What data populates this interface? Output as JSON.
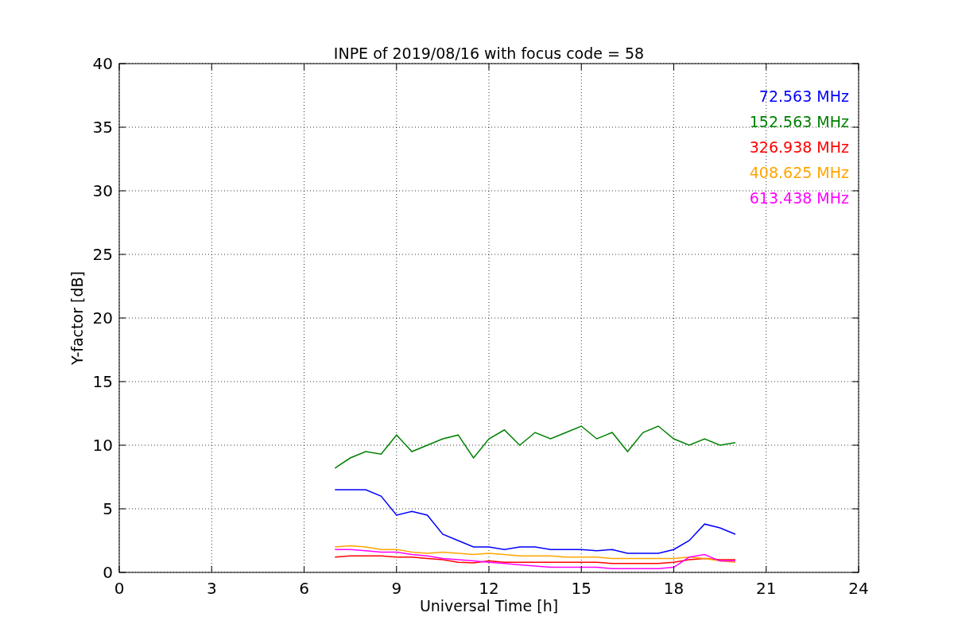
{
  "chart_data": {
    "type": "line",
    "title": "INPE of 2019/08/16 with focus code = 58",
    "xlabel": "Universal Time [h]",
    "ylabel": "Y-factor [dB]",
    "x": [
      7,
      7.5,
      8,
      8.5,
      9,
      9.5,
      10,
      10.5,
      11,
      11.5,
      12,
      12.5,
      13,
      13.5,
      14,
      14.5,
      15,
      15.5,
      16,
      16.5,
      17,
      17.5,
      18,
      18.5,
      19,
      19.5,
      20
    ],
    "series": [
      {
        "name": "72.563 MHz",
        "color": "#0000ff",
        "values": [
          6.5,
          6.5,
          6.5,
          6,
          4.5,
          4.8,
          4.5,
          3,
          2.5,
          2,
          2,
          1.8,
          2,
          2,
          1.8,
          1.8,
          1.8,
          1.7,
          1.8,
          1.5,
          1.5,
          1.5,
          1.8,
          2.5,
          3.8,
          3.5,
          3
        ]
      },
      {
        "name": "152.563 MHz",
        "color": "#008000",
        "values": [
          8.2,
          9,
          9.5,
          9.3,
          10.8,
          9.5,
          10,
          10.5,
          10.8,
          9,
          10.5,
          11.2,
          10,
          11,
          10.5,
          11,
          11.5,
          10.5,
          11,
          9.5,
          11,
          11.5,
          10.5,
          10,
          10.5,
          10,
          10.2
        ]
      },
      {
        "name": "326.938 MHz",
        "color": "#ff0000",
        "values": [
          1.2,
          1.3,
          1.3,
          1.3,
          1.2,
          1.2,
          1.1,
          1,
          0.8,
          0.75,
          0.9,
          0.8,
          0.8,
          0.8,
          0.8,
          0.8,
          0.8,
          0.8,
          0.7,
          0.7,
          0.7,
          0.7,
          0.8,
          1,
          1.1,
          1,
          1
        ]
      },
      {
        "name": "408.625 MHz",
        "color": "#ffa500",
        "values": [
          2,
          2.1,
          2,
          1.8,
          1.8,
          1.6,
          1.5,
          1.6,
          1.5,
          1.4,
          1.5,
          1.4,
          1.3,
          1.3,
          1.3,
          1.2,
          1.2,
          1.2,
          1.1,
          1.1,
          1.1,
          1.1,
          1.1,
          1.2,
          1.1,
          0.9,
          0.8
        ]
      },
      {
        "name": "613.438 MHz",
        "color": "#ff00ff",
        "values": [
          1.8,
          1.8,
          1.7,
          1.6,
          1.6,
          1.4,
          1.3,
          1.1,
          1,
          0.9,
          0.8,
          0.7,
          0.6,
          0.5,
          0.4,
          0.4,
          0.4,
          0.4,
          0.3,
          0.3,
          0.3,
          0.3,
          0.4,
          1.2,
          1.4,
          0.9,
          0.9
        ]
      }
    ],
    "grid": true,
    "xlim": [
      0,
      24
    ],
    "ylim": [
      0,
      40
    ],
    "xticks": [
      0,
      3,
      6,
      9,
      12,
      15,
      18,
      21,
      24
    ],
    "yticks": [
      0,
      5,
      10,
      15,
      20,
      25,
      30,
      35,
      40
    ]
  }
}
